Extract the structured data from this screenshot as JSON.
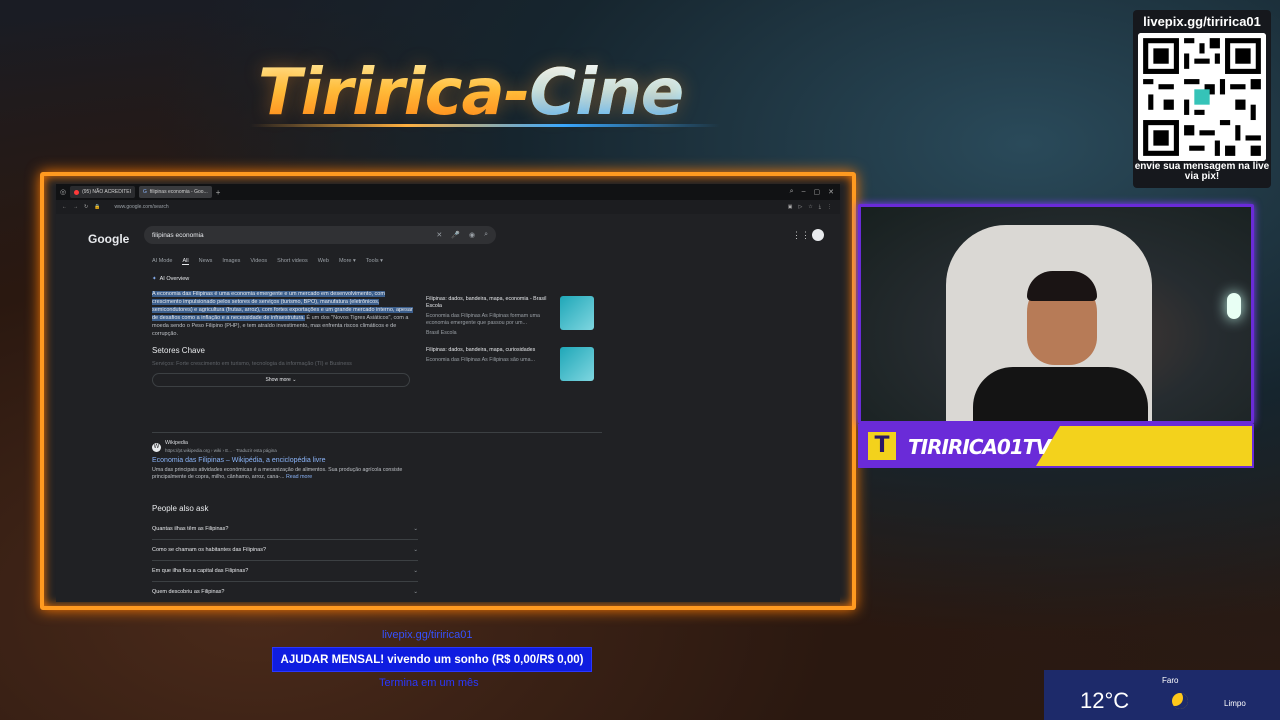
{
  "overlay": {
    "brand_part1": "Tiririca-",
    "brand_part2": "Cine",
    "qr_title": "livepix.gg/tiririca01",
    "qr_message": "envie sua mensagem na live via pix!",
    "channel_name": "TIRIRICA01TV",
    "channel_logo": "T",
    "pix_url": "livepix.gg/tiririca01",
    "goal_text": "AJUDAR MENSAL! vivendo um sonho (R$ 0,00/R$ 0,00)",
    "goal_end": "Termina em um mês",
    "weather": {
      "city": "Faro",
      "temp": "12°C",
      "condition": "Limpo"
    },
    "colors": {
      "frame": "#ff9a20",
      "cam_border": "#6a2bd8",
      "nameplate": "#f3d21c",
      "goal_bg": "#0f1de0"
    }
  },
  "browser": {
    "tabs": [
      {
        "label": "(95) NÃO ACREDITEI",
        "active": false
      },
      {
        "label": "filipinas economia - Goo...",
        "active": true
      }
    ],
    "url": "www.google.com/search",
    "google_logo": "Google",
    "search_query": "filipinas economia",
    "nav_tabs": [
      "AI Mode",
      "All",
      "News",
      "Images",
      "Videos",
      "Short videos",
      "Web",
      "More ▾",
      "Tools ▾"
    ],
    "ai_overview_label": "AI Overview",
    "ai_text_highlight": "A economia das Filipinas é uma economia emergente e um mercado em desenvolvimento, com crescimento impulsionado pelos setores de serviços (turismo, BPO), manufatura (eletrônicos, semicondutores) e agricultura (frutas, arroz), com fortes exportações e um grande mercado interno, apesar de desafios como a inflação e a necessidade de infraestrutura.",
    "ai_text_rest": " É um dos \"Novos Tigres Asiáticos\", com a moeda sendo o Peso Filipino (PHP), e tem atraído investimento, mas enfrenta riscos climáticos e de corrupção.",
    "section_heading": "Setores Chave",
    "faded_line": "Serviços: Forte crescimento em turismo, tecnologia da informação (TI) e Business",
    "show_more": "Show more",
    "cards": [
      {
        "title": "Filipinas: dados, bandeira, mapa, economia - Brasil Escola",
        "desc": "Economia das Filipinas As Filipinas formam uma economia emergente que passou por um...",
        "source": "Brasil Escola"
      },
      {
        "title": "Filipinas: dados, bandeira, mapa, curiosidades",
        "desc": "Economia das Filipinas As Filipinas são uma..."
      }
    ],
    "result": {
      "site": "Wikipedia",
      "site_url": "https://pt.wikipedia.org › wiki › E... · Traduzir esta página",
      "title": "Economia das Filipinas – Wikipédia, a enciclopédia livre",
      "snippet": "Uma das principais atividades económicas é a mecanização de alimentos. Sua produção agrícola consiste principalmente de copra, milho, cânhamo, arroz, cana-... ",
      "read_more": "Read more"
    },
    "paa_title": "People also ask",
    "paa_questions": [
      "Quantas ilhas têm as Filipinas?",
      "Como se chamam os habitantes das Filipinas?",
      "Em que ilha fica a capital das Filipinas?",
      "Quem descobriu as Filipinas?"
    ]
  }
}
